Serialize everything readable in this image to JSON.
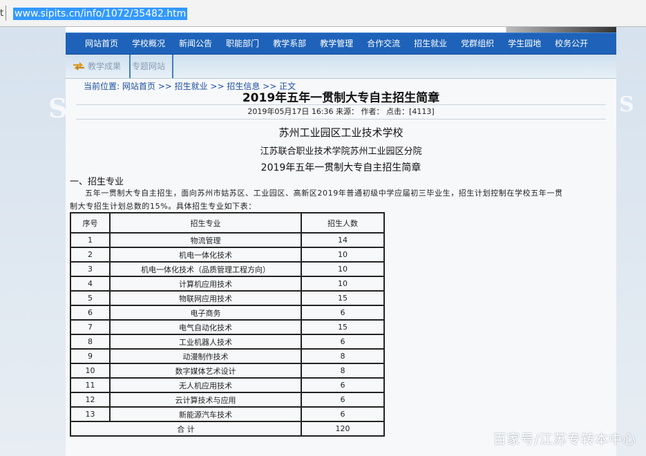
{
  "address_bar": {
    "url": "www.sipits.cn/info/1072/35482.htm",
    "left_char": "t"
  },
  "nav": {
    "items": [
      "网站首页",
      "学校概况",
      "新闻公告",
      "职能部门",
      "教学系部",
      "教学管理",
      "合作交流",
      "招生就业",
      "党群组织",
      "学生园地",
      "校务公开"
    ]
  },
  "subnav": {
    "items": [
      "教学成果",
      "专题网站"
    ]
  },
  "breadcrumb": {
    "prefix": "当前位置:",
    "path": "网站首页 >> 招生就业 >> 招生信息 >> 正文"
  },
  "article": {
    "title": "2019年五年一贯制大专自主招生简章",
    "meta": "2019年05月17日 16:36 来源：    作者：   点击：[4113]",
    "heading1": "苏州工业园区工业技术学校",
    "heading2": "江苏联合职业技术学院苏州工业园区分院",
    "heading3": "2019年五年一贯制大专自主招生简章",
    "section1": "一、招生专业",
    "para_line1": "五年一贯制大专自主招生，面向苏州市姑苏区、工业园区、高新区2019年普通初级中学应届初三毕业生，招生计划控制在学校五年一贯",
    "para_line2": "制大专招生计划总数的15%。具体招生专业如下表："
  },
  "table": {
    "headers": [
      "序号",
      "招生专业",
      "招生人数"
    ],
    "rows": [
      [
        "1",
        "物流管理",
        "14"
      ],
      [
        "2",
        "机电一体化技术",
        "10"
      ],
      [
        "3",
        "机电一体化技术（品质管理工程方向）",
        "10"
      ],
      [
        "4",
        "计算机应用技术",
        "10"
      ],
      [
        "5",
        "物联网应用技术",
        "15"
      ],
      [
        "6",
        "电子商务",
        "6"
      ],
      [
        "7",
        "电气自动化技术",
        "15"
      ],
      [
        "8",
        "工业机器人技术",
        "6"
      ],
      [
        "9",
        "动漫制作技术",
        "8"
      ],
      [
        "10",
        "数字媒体艺术设计",
        "8"
      ],
      [
        "11",
        "无人机应用技术",
        "6"
      ],
      [
        "12",
        "云计算技术与应用",
        "6"
      ],
      [
        "13",
        "新能源汽车技术",
        "6"
      ]
    ],
    "total_label": "合 计",
    "total_value": "120"
  },
  "footer_watermark": "百家号/江苏专转本中心",
  "side_watermark_left": "S",
  "side_watermark_right": "S\n校",
  "colors": {
    "nav_bg": "#1e63b9",
    "link": "#1c4fa0",
    "selection": "#3399ff"
  },
  "icons": {
    "subnav_first": "swap-arrows-icon"
  }
}
